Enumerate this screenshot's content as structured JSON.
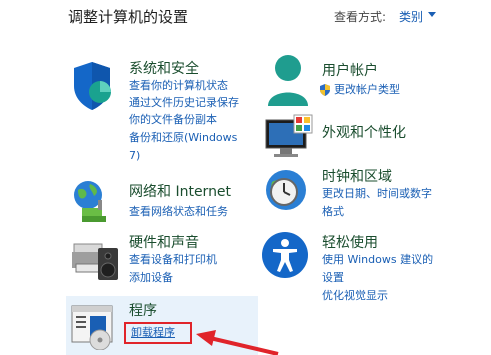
{
  "header": {
    "title": "调整计算机的设置",
    "view_by_label": "查看方式:",
    "view_by_value": "类别"
  },
  "categories": {
    "security": {
      "title": "系统和安全",
      "links": [
        "查看你的计算机状态",
        "通过文件历史记录保存",
        "你的文件备份副本",
        "备份和还原(Windows",
        "7)"
      ]
    },
    "network": {
      "title": "网络和 Internet",
      "links": [
        "查看网络状态和任务"
      ]
    },
    "hardware": {
      "title": "硬件和声音",
      "links": [
        "查看设备和打印机",
        "添加设备"
      ]
    },
    "programs": {
      "title": "程序",
      "links": [
        "卸载程序"
      ]
    },
    "accounts": {
      "title": "用户帐户",
      "links": [
        "更改帐户类型"
      ]
    },
    "appearance": {
      "title": "外观和个性化",
      "links": []
    },
    "clock": {
      "title": "时钟和区域",
      "links": [
        "更改日期、时间或数字",
        "格式"
      ]
    },
    "ease": {
      "title": "轻松使用",
      "links": [
        "使用 Windows 建议的",
        "设置",
        "优化视觉显示"
      ]
    }
  },
  "colors": {
    "accent": "#1a5fb4",
    "highlight": "#e0242a",
    "selected_bg": "#e8f2fb"
  }
}
